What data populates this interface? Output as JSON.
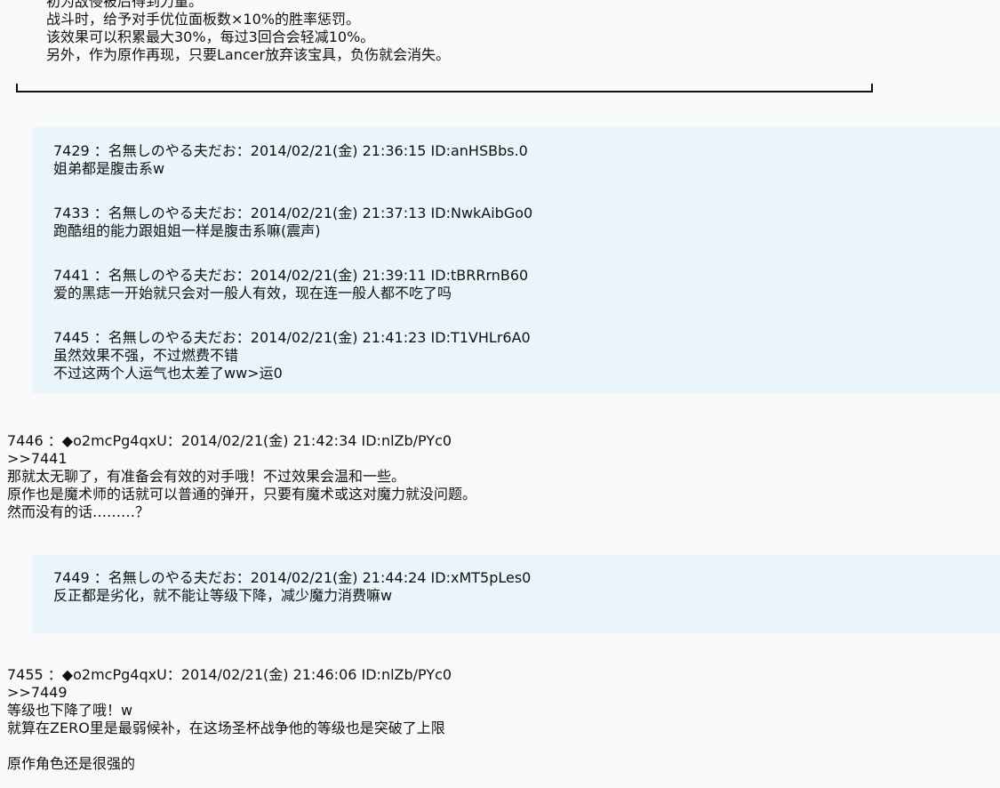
{
  "intro_box": {
    "lines": [
      "初为敌侵被后得到力量。",
      "战斗时，给予对手优位面板数×10%的胜率惩罚。",
      "该效果可以积累最大30%，每过3回合会轻减10%。",
      "另外，作为原作再现，只要Lancer放弃该宝具，负伤就会消失。"
    ]
  },
  "quote_block_1": [
    {
      "header": "7429 ：名無しのやる夫だお：2014/02/21(金) 21:36:15 ID:anHSBbs.0",
      "lines": [
        "姐弟都是腹击系w"
      ]
    },
    {
      "header": "7433 ：名無しのやる夫だお：2014/02/21(金) 21:37:13 ID:NwkAibGo0",
      "lines": [
        "跑酷组的能力跟姐姐一样是腹击系嘛(震声)"
      ]
    },
    {
      "header": "7441 ：名無しのやる夫だお：2014/02/21(金) 21:39:11 ID:tBRRrnB60",
      "lines": [
        "爱的黑痣一开始就只会对一般人有效，现在连一般人都不吃了吗"
      ]
    },
    {
      "header": "7445 ：名無しのやる夫だお：2014/02/21(金) 21:41:23 ID:T1VHLr6A0",
      "lines": [
        "虽然效果不强，不过燃费不错",
        "不过这两个人运气也太差了ww>运0"
      ]
    }
  ],
  "post_1": {
    "header": "7446 ：◆o2mcPg4qxU：2014/02/21(金) 21:42:34 ID:nlZb/PYc0",
    "lines": [
      ">>7441",
      "那就太无聊了，有准备会有效的对手哦！不过效果会温和一些。",
      "原作也是魔术师的话就可以普通的弹开，只要有魔术或这对魔力就没问题。",
      "然而没有的话………？"
    ]
  },
  "quote_block_2": [
    {
      "header": "7449 ：名無しのやる夫だお：2014/02/21(金) 21:44:24 ID:xMT5pLes0",
      "lines": [
        "反正都是劣化，就不能让等级下降，减少魔力消费嘛w"
      ]
    }
  ],
  "post_2": {
    "header": "7455 ：◆o2mcPg4qxU：2014/02/21(金) 21:46:06 ID:nlZb/PYc0",
    "lines": [
      ">>7449",
      "等级也下降了哦！w",
      "就算在ZERO里是最弱候补，在这场圣杯战争他的等级也是突破了上限"
    ],
    "lines_after_gap": [
      "原作角色还是很强的"
    ]
  }
}
